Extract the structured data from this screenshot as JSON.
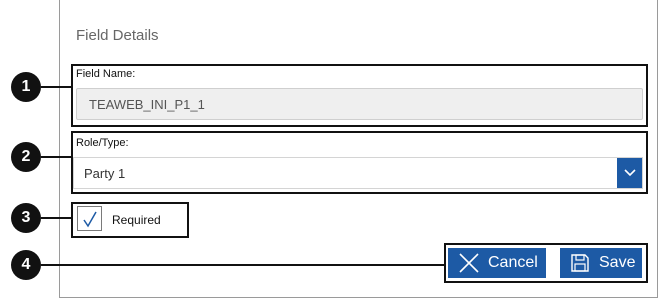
{
  "dialog": {
    "title": "Field Details"
  },
  "callouts": [
    "1",
    "2",
    "3",
    "4"
  ],
  "field_name": {
    "label": "Field Name:",
    "value": "TEAWEB_INI_P1_1"
  },
  "role_type": {
    "label": "Role/Type:",
    "selected": "Party 1"
  },
  "required": {
    "label": "Required",
    "checked": true
  },
  "buttons": {
    "cancel": "Cancel",
    "save": "Save"
  },
  "colors": {
    "accent": "#1d5aa5",
    "input_bg": "#efefef",
    "callout": "#111111"
  },
  "icons": {
    "dropdown": "chevron-down-icon",
    "cancel": "close-icon",
    "save": "floppy-disk-icon",
    "checkbox": "checkmark-icon"
  }
}
